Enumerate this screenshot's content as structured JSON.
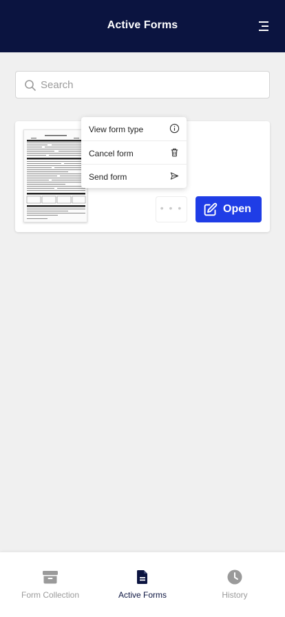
{
  "header": {
    "title": "Active Forms"
  },
  "search": {
    "placeholder": "Search",
    "value": ""
  },
  "card": {
    "open_label": "Open",
    "more_label": "• • •"
  },
  "dropdown": {
    "items": [
      {
        "label": "View form type",
        "icon": "info-circle-icon"
      },
      {
        "label": "Cancel form",
        "icon": "trash-icon"
      },
      {
        "label": "Send form",
        "icon": "send-icon"
      }
    ]
  },
  "bottom_nav": {
    "items": [
      {
        "label": "Form Collection",
        "icon": "archive-box-icon",
        "active": false
      },
      {
        "label": "Active Forms",
        "icon": "document-icon",
        "active": true
      },
      {
        "label": "History",
        "icon": "clock-icon",
        "active": false
      }
    ]
  },
  "colors": {
    "header_bg": "#0b1440",
    "accent": "#1f3de6",
    "background": "#f0f0f0"
  }
}
